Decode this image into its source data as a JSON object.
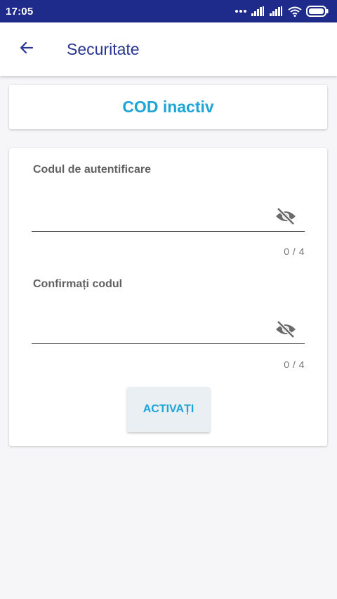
{
  "status_bar": {
    "time": "17:05",
    "icons": [
      "more-dots-icon",
      "signal-icon",
      "signal-icon",
      "wifi-icon",
      "battery-icon"
    ]
  },
  "header": {
    "back_icon": "arrow-left-icon",
    "title": "Securitate"
  },
  "status_card": {
    "text": "COD inactiv"
  },
  "form": {
    "auth_code": {
      "label": "Codul de autentificare",
      "value": "",
      "counter": "0 / 4",
      "visibility_icon": "eye-off-icon"
    },
    "confirm_code": {
      "label": "Confirmați codul",
      "value": "",
      "counter": "0 / 4",
      "visibility_icon": "eye-off-icon"
    },
    "activate_label": "ACTIVAȚI"
  },
  "colors": {
    "status_bar": "#1f2b8a",
    "title": "#283593",
    "accent": "#1ea5d8",
    "background": "#f6f6f8"
  }
}
